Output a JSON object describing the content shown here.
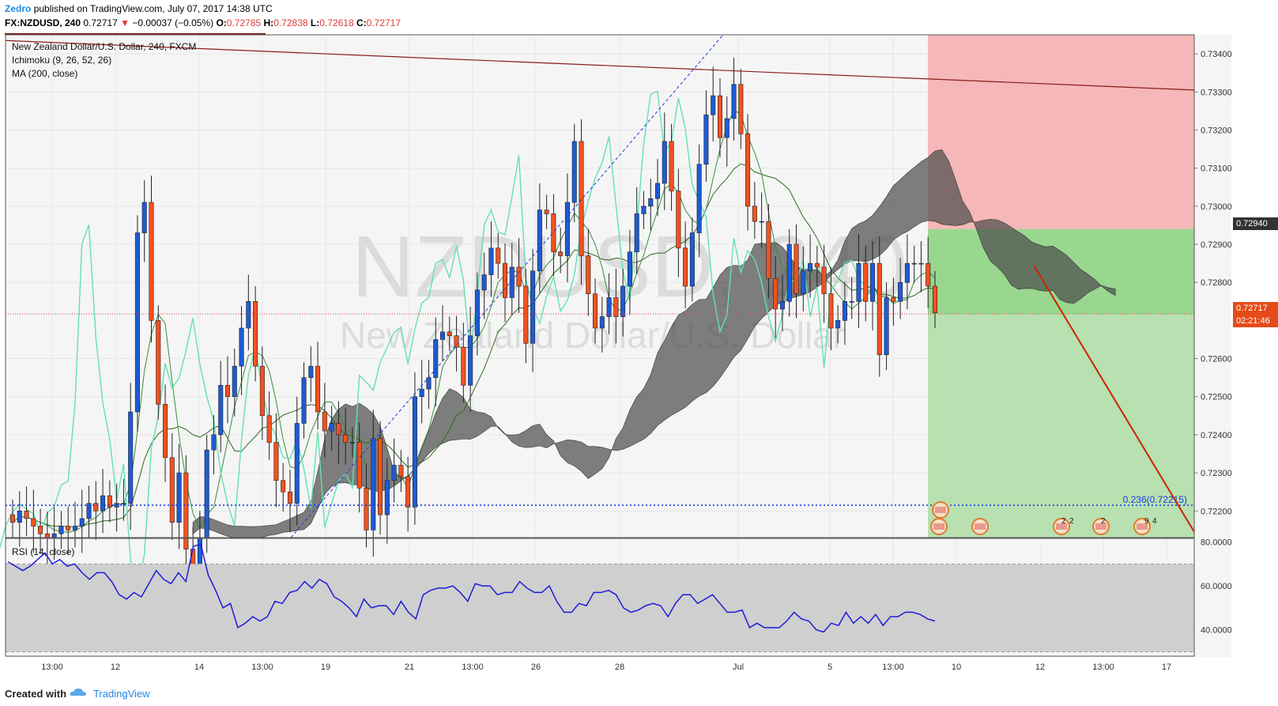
{
  "header": {
    "publisher": "Zedro",
    "published_text": "published on TradingView.com, July 07, 2017 14:38 UTC",
    "symbol": "FX:NZDUSD, 240",
    "last": "0.72717",
    "change_arrow": "▼",
    "change": "−0.00037 (−0.05%)",
    "o_label": "O:",
    "o_value": "0.72785",
    "h_label": "H:",
    "h_value": "0.72838",
    "l_label": "L:",
    "l_value": "0.72618",
    "c_label": "C:",
    "c_value": "0.72717"
  },
  "legend": {
    "title": "New Zealand Dollar/U.S. Dollar, 240, FXCM",
    "ichimoku": "Ichimoku (9, 26, 52, 26)",
    "ma": "MA (200, close)",
    "rsi": "RSI (14, close)"
  },
  "watermark": {
    "symbol": "NZDUSD, 240",
    "name": "New Zealand Dollar/U.S. Dollar"
  },
  "price_badges": {
    "target": "0.72940",
    "last": "0.72717",
    "timer": "02:21:46"
  },
  "fib_label": "0.236(0.72215)",
  "event_counts": [
    "2",
    "2",
    "2",
    "9",
    "4"
  ],
  "footer": {
    "created_with": "Created with",
    "brand": "TradingView"
  },
  "colors": {
    "up_candle": "#1e5bd6",
    "down_candle": "#f4511e",
    "kumo_dark": "#4a4a4a",
    "kumo_light": "#bdbdbd",
    "tenkan": "#64e0b4",
    "kijun": "#2e6b1e",
    "rsi_line": "#1c1cd6",
    "stop_zone": "#f5b7b7",
    "target_zone": "#b8e0b0",
    "trendline": "#8b1a1a",
    "forecast_line": "#cc2200",
    "fib_line": "#1a3de0"
  },
  "chart_data": [
    {
      "type": "candlestick",
      "title": "New Zealand Dollar/U.S. Dollar, 240, FXCM",
      "x_tick_labels": [
        "13:00",
        "12",
        "14",
        "13:00",
        "19",
        "21",
        "13:00",
        "26",
        "28",
        "Jul",
        "5",
        "13:00",
        "10",
        "12",
        "13:00",
        "17"
      ],
      "y_tick_labels": [
        "0.73400",
        "0.73300",
        "0.73200",
        "0.73100",
        "0.73000",
        "0.72900",
        "0.72800",
        "0.72600",
        "0.72500",
        "0.72400",
        "0.72300",
        "0.72200"
      ],
      "ylim": [
        0.7213,
        0.7345
      ],
      "grid": true,
      "series": [
        {
          "name": "Ichimoku (9, 26, 52, 26)"
        },
        {
          "name": "MA (200, close)"
        }
      ],
      "annotations": {
        "fibonacci_level": {
          "label": "0.236(0.72215)",
          "value": 0.72215
        },
        "position_target_entry": 0.7294,
        "last_price": 0.72717
      },
      "closes": [
        0.7217,
        0.722,
        0.7218,
        0.7216,
        0.7214,
        0.7213,
        0.7214,
        0.7216,
        0.7215,
        0.7216,
        0.7218,
        0.7222,
        0.722,
        0.7224,
        0.7221,
        0.7222,
        0.7222,
        0.7246,
        0.7293,
        0.7301,
        0.727,
        0.7248,
        0.7234,
        0.7217,
        0.723,
        0.721,
        0.7206,
        0.7213,
        0.7236,
        0.724,
        0.7253,
        0.725,
        0.7258,
        0.7268,
        0.7275,
        0.7258,
        0.7245,
        0.7238,
        0.7228,
        0.7225,
        0.7222,
        0.7243,
        0.7255,
        0.7258,
        0.7246,
        0.7241,
        0.7243,
        0.724,
        0.7238,
        0.7238,
        0.7226,
        0.7215,
        0.7239,
        0.7219,
        0.7228,
        0.7232,
        0.7229,
        0.7221,
        0.725,
        0.7252,
        0.7255,
        0.7265,
        0.7267,
        0.7266,
        0.7263,
        0.7253,
        0.7266,
        0.7278,
        0.7282,
        0.7289,
        0.7285,
        0.7276,
        0.7284,
        0.7279,
        0.7264,
        0.7283,
        0.7299,
        0.7298,
        0.7288,
        0.7287,
        0.7301,
        0.7317,
        0.7287,
        0.7277,
        0.7268,
        0.7271,
        0.7276,
        0.7271,
        0.7279,
        0.7288,
        0.7298,
        0.73,
        0.7302,
        0.7306,
        0.7317,
        0.7304,
        0.7289,
        0.7279,
        0.7293,
        0.7311,
        0.7324,
        0.7329,
        0.7318,
        0.7323,
        0.7332,
        0.7319,
        0.73,
        0.7296,
        0.7296,
        0.7281,
        0.7273,
        0.7275,
        0.729,
        0.7277,
        0.7283,
        0.7285,
        0.7284,
        0.7277,
        0.7268,
        0.727,
        0.7275,
        0.7275,
        0.7285,
        0.7275,
        0.7285,
        0.7261,
        0.7276,
        0.7275,
        0.728,
        0.7285,
        0.7285,
        0.7285,
        0.7279,
        0.7272
      ]
    },
    {
      "type": "line",
      "title": "RSI (14, close)",
      "y_tick_labels": [
        "80.0000",
        "60.0000",
        "40.0000"
      ],
      "ylim": [
        28,
        82
      ],
      "series": [
        {
          "name": "RSI (14, close)",
          "values": [
            71,
            69,
            67,
            69,
            72,
            75,
            70,
            72,
            69,
            70,
            66,
            63,
            66,
            66,
            62,
            56,
            54,
            57,
            55,
            61,
            67,
            63,
            61,
            66,
            62,
            78,
            79,
            65,
            58,
            50,
            52,
            41,
            43,
            46,
            44,
            46,
            53,
            52,
            57,
            58,
            62,
            59,
            63,
            61,
            55,
            53,
            50,
            46,
            54,
            50,
            51,
            51,
            47,
            53,
            48,
            45,
            56,
            58,
            59,
            59,
            60,
            57,
            53,
            61,
            60,
            60,
            56,
            57,
            57,
            62,
            59,
            57,
            57,
            60,
            53,
            48,
            48,
            52,
            51,
            57,
            57,
            58,
            56,
            50,
            48,
            49,
            51,
            52,
            51,
            46,
            52,
            56,
            56,
            52,
            54,
            56,
            52,
            48,
            48,
            49,
            41,
            43,
            41,
            41,
            41,
            44,
            48,
            45,
            44,
            40,
            39,
            43,
            42,
            48,
            43,
            46,
            43,
            47,
            42,
            46,
            46,
            48,
            48,
            47,
            45,
            44
          ]
        }
      ]
    }
  ]
}
